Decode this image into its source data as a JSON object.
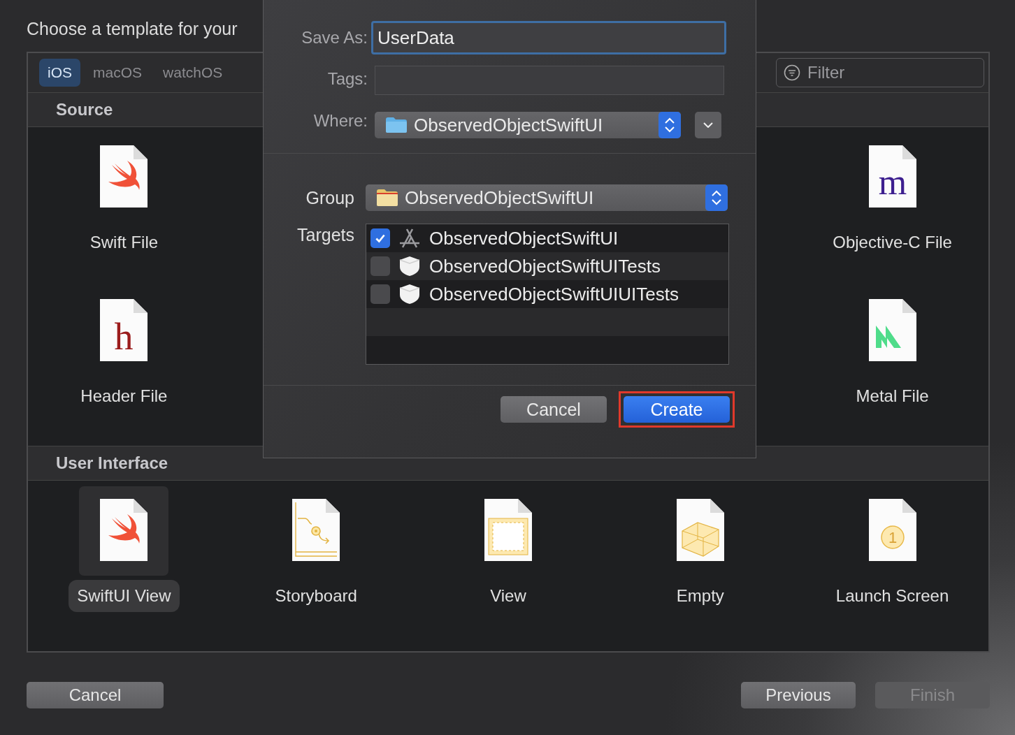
{
  "window": {
    "title": "Choose a template for your"
  },
  "platform_tabs": [
    {
      "label": "iOS",
      "selected": true
    },
    {
      "label": "macOS",
      "selected": false
    },
    {
      "label": "watchOS",
      "selected": false
    }
  ],
  "filter": {
    "placeholder": "Filter"
  },
  "sections": [
    {
      "title": "Source",
      "templates": [
        {
          "label": "Swift File",
          "kind": "swift",
          "selected": false
        },
        {
          "label": "Objective-C File",
          "kind": "objc",
          "glyph": "m",
          "selected": false
        },
        {
          "label": "Header File",
          "kind": "header",
          "glyph": "h",
          "selected": false
        },
        {
          "label": "Metal File",
          "kind": "metal",
          "selected": false
        }
      ]
    },
    {
      "title": "User Interface",
      "templates": [
        {
          "label": "SwiftUI View",
          "kind": "swift",
          "selected": true
        },
        {
          "label": "Storyboard",
          "kind": "storyboard",
          "selected": false
        },
        {
          "label": "View",
          "kind": "view",
          "selected": false
        },
        {
          "label": "Empty",
          "kind": "empty",
          "selected": false
        },
        {
          "label": "Launch Screen",
          "kind": "launch",
          "glyph": "1",
          "selected": false
        }
      ]
    }
  ],
  "save_dialog": {
    "save_as": {
      "label": "Save As:",
      "value": "UserData"
    },
    "tags": {
      "label": "Tags:"
    },
    "where": {
      "label": "Where:",
      "value": "ObservedObjectSwiftUI"
    },
    "group": {
      "label": "Group",
      "value": "ObservedObjectSwiftUI"
    },
    "targets": {
      "label": "Targets",
      "items": [
        {
          "name": "ObservedObjectSwiftUI",
          "kind": "app",
          "checked": true
        },
        {
          "name": "ObservedObjectSwiftUITests",
          "kind": "test",
          "checked": false
        },
        {
          "name": "ObservedObjectSwiftUIUITests",
          "kind": "test",
          "checked": false
        }
      ]
    },
    "buttons": [
      {
        "label": "Cancel",
        "kind": "normal",
        "highlighted": false
      },
      {
        "label": "Create",
        "kind": "default",
        "highlighted": true
      }
    ]
  },
  "footer_buttons": [
    {
      "label": "Cancel",
      "disabled": false
    },
    {
      "label": "Previous",
      "disabled": false
    },
    {
      "label": "Finish",
      "disabled": true
    }
  ]
}
